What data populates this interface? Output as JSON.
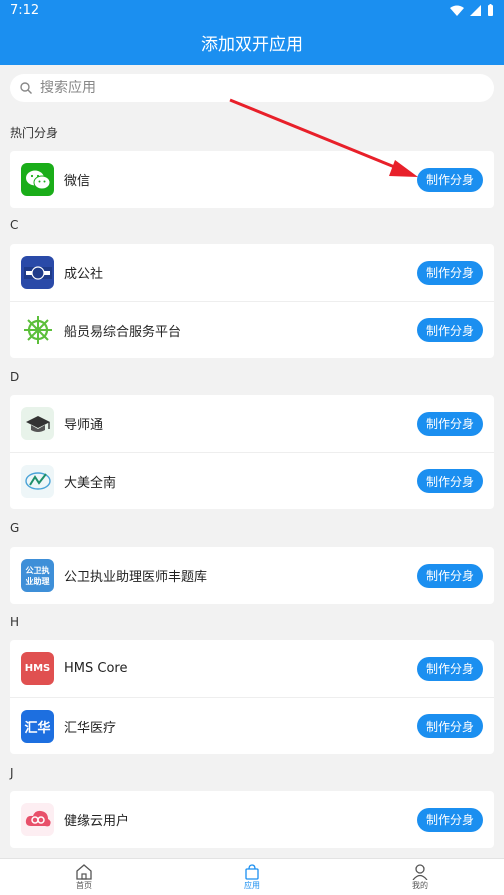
{
  "status": {
    "time": "7:12"
  },
  "header": {
    "title": "添加双开应用"
  },
  "search": {
    "placeholder": "搜索应用"
  },
  "sections": [
    {
      "label": "热门分身",
      "apps": [
        {
          "name": "微信",
          "button": "制作分身",
          "icon": "wechat-icon",
          "color": "#1aad19"
        }
      ]
    },
    {
      "label": "C",
      "apps": [
        {
          "name": "成公社",
          "button": "制作分身",
          "icon": "chenggongshe-icon",
          "color": "#2a4aa8"
        },
        {
          "name": "船员易综合服务平台",
          "button": "制作分身",
          "icon": "ship-wheel-icon",
          "color": "#5cbf3b"
        }
      ]
    },
    {
      "label": "D",
      "apps": [
        {
          "name": "导师通",
          "button": "制作分身",
          "icon": "graduation-cap-icon",
          "color": "#444444"
        },
        {
          "name": "大美全南",
          "button": "制作分身",
          "icon": "damei-logo-icon",
          "color": "#1f8f6a"
        }
      ]
    },
    {
      "label": "G",
      "apps": [
        {
          "name": "公卫执业助理医师丰题库",
          "button": "制作分身",
          "icon": "gongwei-icon",
          "color": "#3e8fd8",
          "icon_text": "公卫执业助理"
        }
      ]
    },
    {
      "label": "H",
      "apps": [
        {
          "name": "HMS Core",
          "button": "制作分身",
          "icon": "hms-icon",
          "color": "#e05050",
          "icon_text": "HMS"
        },
        {
          "name": "汇华医疗",
          "button": "制作分身",
          "icon": "huihua-icon",
          "color": "#1d6fe0",
          "icon_text": "汇华"
        }
      ]
    },
    {
      "label": "J",
      "apps": [
        {
          "name": "健缘云用户",
          "button": "制作分身",
          "icon": "jianyuan-cloud-icon",
          "color": "#e8506a"
        }
      ]
    }
  ],
  "tabbar": [
    {
      "label": "首页",
      "icon": "home-icon"
    },
    {
      "label": "应用",
      "icon": "bag-icon",
      "active": true
    },
    {
      "label": "我的",
      "icon": "user-icon"
    }
  ],
  "colors": {
    "accent": "#1b8ff0",
    "arrow": "#e8202a"
  }
}
